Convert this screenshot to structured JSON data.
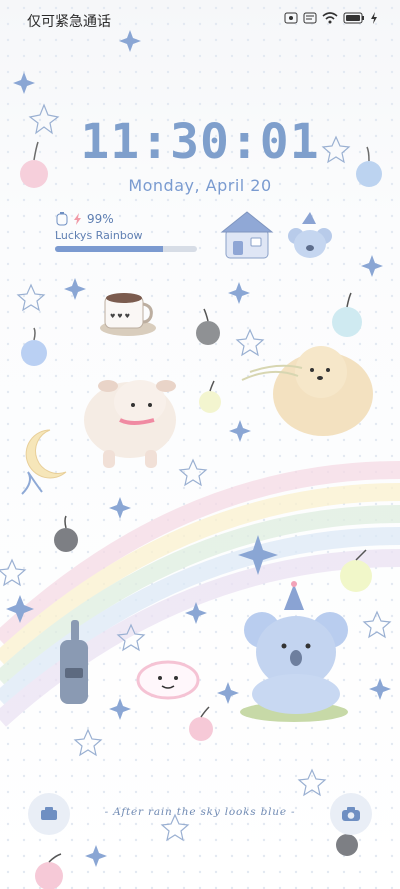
{
  "status_bar": {
    "carrier_text": "仅可紧急通话",
    "icons": [
      "nfc-icon",
      "message-icon",
      "wifi-icon",
      "battery-icon",
      "charging-icon"
    ]
  },
  "lockscreen": {
    "time": "11:30:01",
    "date": "Monday, April  20",
    "battery": {
      "percent_text": "99%",
      "level": 0.99,
      "label": "Luckys Rainbow",
      "bar_level": 0.76
    },
    "slogan": "- After rain the sky looks blue -"
  },
  "shortcuts": {
    "left": "camera-lens-icon",
    "right": "camera-icon"
  },
  "wallpaper": {
    "theme": "pastel rainbow with cute animals",
    "colors": {
      "accent": "#7f9fcc",
      "rainbow_pink": "#f4d7e3",
      "rainbow_blue": "#dfe9f6"
    }
  }
}
